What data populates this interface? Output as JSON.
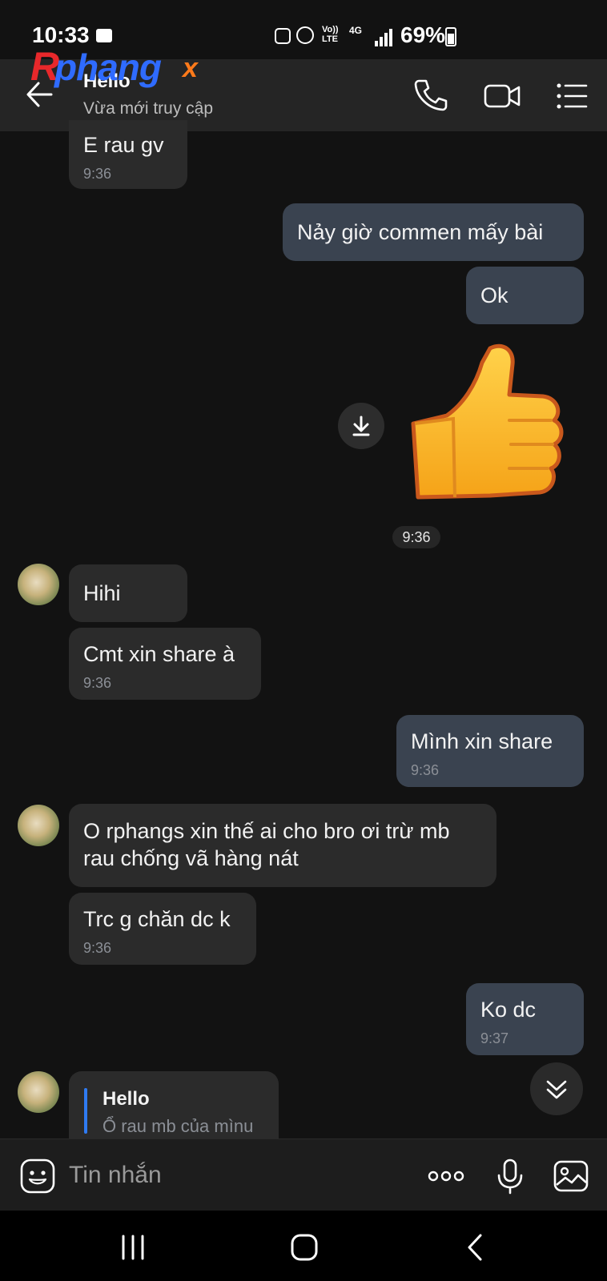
{
  "status_bar": {
    "time": "10:33",
    "battery": "69%",
    "network_label_1": "Vo))",
    "network_label_2": "LTE",
    "network_label_3": "4G"
  },
  "watermark": {
    "logo_text": "Rphangx"
  },
  "header": {
    "contact_name": "Hello",
    "status": "Vừa mới truy cập"
  },
  "messages": [
    {
      "side": "in",
      "text": "E rau gv",
      "time": "9:36"
    },
    {
      "side": "out",
      "text": "Nảy giờ commen mấy bài"
    },
    {
      "side": "out",
      "text": "Ok"
    },
    {
      "side": "out",
      "sticker": "thumbs-up",
      "time": "9:36"
    },
    {
      "side": "in",
      "text": "Hihi"
    },
    {
      "side": "in",
      "text": "Cmt xin share à",
      "time": "9:36"
    },
    {
      "side": "out",
      "text": "Mình xin share",
      "time": "9:36"
    },
    {
      "side": "in",
      "text_line1": "O rphangs xin thế ai cho bro ơi trừ mb",
      "text_line2": "rau chống vã hàng nát"
    },
    {
      "side": "in",
      "text": "Trc g chăn dc k",
      "time": "9:36"
    },
    {
      "side": "out",
      "text": "Ko dc",
      "time": "9:37"
    },
    {
      "side": "in",
      "reply_name": "Hello",
      "reply_text": "Ổ rau mb của mìnu"
    }
  ],
  "input": {
    "placeholder": "Tin nhắn"
  },
  "colors": {
    "incoming_bubble": "#2b2b2b",
    "outgoing_bubble": "#3a4350",
    "reply_accent": "#2f7bf2"
  }
}
